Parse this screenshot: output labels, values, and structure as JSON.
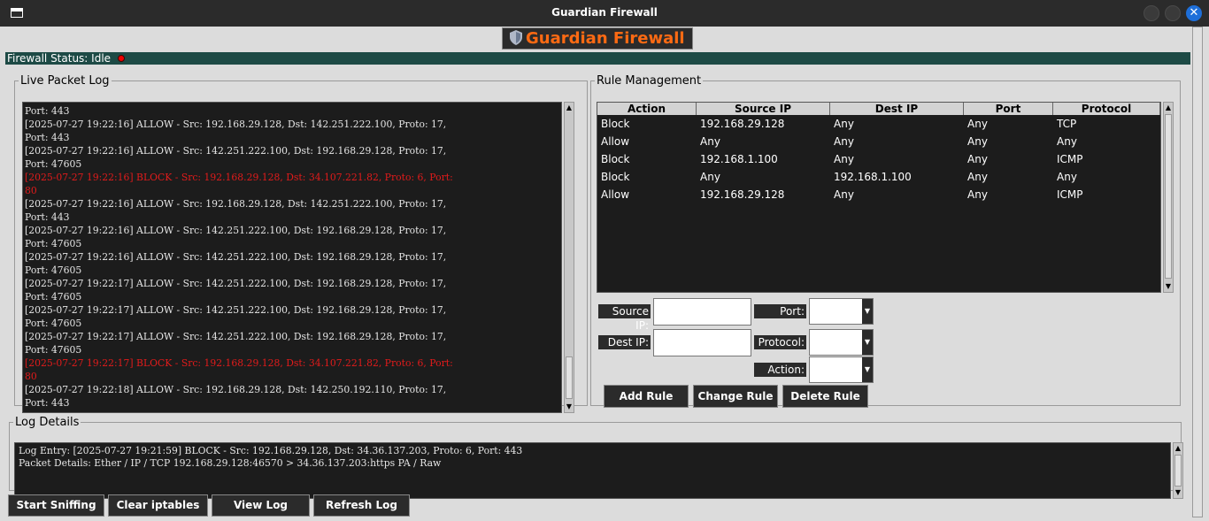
{
  "window": {
    "title": "Guardian Firewall"
  },
  "banner": {
    "text": "Guardian Firewall",
    "icon": "shield-icon",
    "text_color": "#ff6a13"
  },
  "status": {
    "text": "Firewall Status: Idle",
    "indicator_color": "#ee0000"
  },
  "packet_log": {
    "legend": "Live Packet Log",
    "lines": [
      {
        "text": "Port: 443",
        "type": "allow"
      },
      {
        "text": "[2025-07-27 19:22:16] ALLOW - Src: 192.168.29.128, Dst: 142.251.222.100, Proto: 17,",
        "type": "allow"
      },
      {
        "text": "Port: 443",
        "type": "allow"
      },
      {
        "text": "[2025-07-27 19:22:16] ALLOW - Src: 142.251.222.100, Dst: 192.168.29.128, Proto: 17,",
        "type": "allow"
      },
      {
        "text": "Port: 47605",
        "type": "allow"
      },
      {
        "text": "[2025-07-27 19:22:16] BLOCK - Src: 192.168.29.128, Dst: 34.107.221.82, Proto: 6, Port:",
        "type": "block"
      },
      {
        "text": "80",
        "type": "block"
      },
      {
        "text": "[2025-07-27 19:22:16] ALLOW - Src: 192.168.29.128, Dst: 142.251.222.100, Proto: 17,",
        "type": "allow"
      },
      {
        "text": "Port: 443",
        "type": "allow"
      },
      {
        "text": "[2025-07-27 19:22:16] ALLOW - Src: 142.251.222.100, Dst: 192.168.29.128, Proto: 17,",
        "type": "allow"
      },
      {
        "text": "Port: 47605",
        "type": "allow"
      },
      {
        "text": "[2025-07-27 19:22:16] ALLOW - Src: 142.251.222.100, Dst: 192.168.29.128, Proto: 17,",
        "type": "allow"
      },
      {
        "text": "Port: 47605",
        "type": "allow"
      },
      {
        "text": "[2025-07-27 19:22:17] ALLOW - Src: 142.251.222.100, Dst: 192.168.29.128, Proto: 17,",
        "type": "allow"
      },
      {
        "text": "Port: 47605",
        "type": "allow"
      },
      {
        "text": "[2025-07-27 19:22:17] ALLOW - Src: 142.251.222.100, Dst: 192.168.29.128, Proto: 17,",
        "type": "allow"
      },
      {
        "text": "Port: 47605",
        "type": "allow"
      },
      {
        "text": "[2025-07-27 19:22:17] ALLOW - Src: 142.251.222.100, Dst: 192.168.29.128, Proto: 17,",
        "type": "allow"
      },
      {
        "text": "Port: 47605",
        "type": "allow"
      },
      {
        "text": "[2025-07-27 19:22:17] BLOCK - Src: 192.168.29.128, Dst: 34.107.221.82, Proto: 6, Port:",
        "type": "block"
      },
      {
        "text": "80",
        "type": "block"
      },
      {
        "text": "[2025-07-27 19:22:18] ALLOW - Src: 192.168.29.128, Dst: 142.250.192.110, Proto: 17,",
        "type": "allow"
      },
      {
        "text": "Port: 443",
        "type": "allow"
      }
    ],
    "block_color": "#e21b1b"
  },
  "rules": {
    "legend": "Rule Management",
    "columns": [
      "Action",
      "Source IP",
      "Dest IP",
      "Port",
      "Protocol"
    ],
    "rows": [
      [
        "Block",
        "192.168.29.128",
        "Any",
        "Any",
        "TCP"
      ],
      [
        "Allow",
        "Any",
        "Any",
        "Any",
        "Any"
      ],
      [
        "Block",
        "192.168.1.100",
        "Any",
        "Any",
        "ICMP"
      ],
      [
        "Block",
        "Any",
        "192.168.1.100",
        "Any",
        "Any"
      ],
      [
        "Allow",
        "192.168.29.128",
        "Any",
        "Any",
        "ICMP"
      ]
    ]
  },
  "form": {
    "source_ip_label": "Source IP:",
    "dest_ip_label": "Dest IP:",
    "port_label": "Port:",
    "protocol_label": "Protocol:",
    "action_label": "Action:",
    "source_ip_value": "",
    "dest_ip_value": "",
    "port_value": "",
    "protocol_value": "",
    "action_value": "",
    "add_rule_label": "Add Rule",
    "change_rule_label": "Change Rule",
    "delete_rule_label": "Delete Rule"
  },
  "log_details": {
    "legend": "Log Details",
    "entry_line": "Log Entry: [2025-07-27 19:21:59] BLOCK - Src: 192.168.29.128, Dst: 34.36.137.203, Proto: 6, Port: 443",
    "packet_line": "Packet Details: Ether / IP / TCP 192.168.29.128:46570 > 34.36.137.203:https PA / Raw"
  },
  "toolbar": {
    "start_sniffing_label": "Start Sniffing",
    "clear_iptables_label": "Clear iptables",
    "view_log_label": "View Log",
    "refresh_log_label": "Refresh Log"
  }
}
